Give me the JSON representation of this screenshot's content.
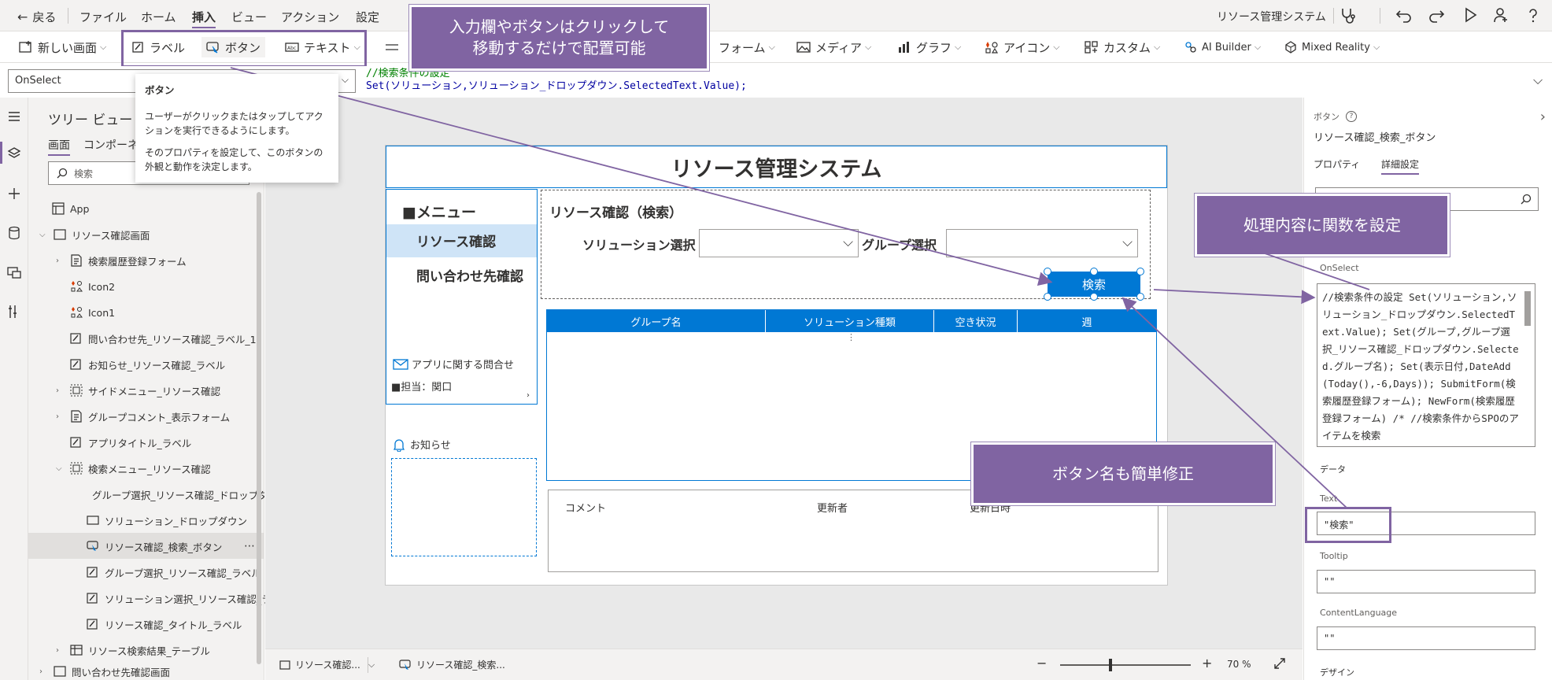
{
  "menubar": {
    "back": "戻る",
    "items": [
      "ファイル",
      "ホーム",
      "挿入",
      "ビュー",
      "アクション",
      "設定"
    ],
    "app_title": "リソース管理システム"
  },
  "ribbon": {
    "new_screen": "新しい画面",
    "label": "ラベル",
    "button": "ボタン",
    "text": "テキスト",
    "form": "フォーム",
    "media": "メディア",
    "chart": "グラフ",
    "icon": "アイコン",
    "custom": "カスタム",
    "ai_builder": "AI Builder",
    "mixed_reality": "Mixed Reality"
  },
  "formula": {
    "property": "OnSelect",
    "line1": "//検索条件の設定",
    "line2": "Set(ソリューション,ソリューション_ドロップダウン.SelectedText.Value);"
  },
  "tooltip": {
    "title": "ボタン",
    "desc1": "ユーザーがクリックまたはタップしてアクションを実行できるようにします。",
    "desc2": "そのプロパティを設定して、このボタンの外観と動作を決定します。"
  },
  "tree": {
    "title": "ツリー ビュー",
    "tab_screen": "画面",
    "tab_components": "コンポーネント",
    "search_placeholder": "検索",
    "nodes": [
      "App",
      "リソース確認画面",
      "検索履歴登録フォーム",
      "Icon2",
      "Icon1",
      "問い合わせ先_リソース確認_ラベル_1",
      "お知らせ_リソース確認_ラベル",
      "サイドメニュー_リソース確認",
      "グループコメント_表示フォーム",
      "アプリタイトル_ラベル",
      "検索メニュー_リソース確認",
      "グループ選択_リソース確認_ドロップダウン",
      "ソリューション_ドロップダウン",
      "リソース確認_検索_ボタン",
      "グループ選択_リソース確認_ラベル",
      "ソリューション選択_リソース確認_ラベル",
      "リソース確認_タイトル_ラベル",
      "リソース検索結果_テーブル",
      "問い合わせ先確認画面"
    ]
  },
  "app": {
    "title": "リソース管理システム",
    "menu_heading": "■メニュー",
    "menu_items": [
      "リソース確認",
      "問い合わせ先確認"
    ],
    "contact": "アプリに関する問合せ",
    "owner": "■担当：関口",
    "notice": "お知らせ",
    "search_title": "リソース確認（検索）",
    "solution_label": "ソリューション選択",
    "group_label": "グループ選択",
    "search_button": "検索",
    "table_headers": [
      "グループ名",
      "ソリューション種類",
      "空き状況",
      "週"
    ],
    "comment_headers": [
      "コメント",
      "更新者",
      "更新日時"
    ]
  },
  "status": {
    "screen_tab": "リソース確認...",
    "control_tab": "リソース確認_検索...",
    "zoom": "70",
    "zoom_unit": "%"
  },
  "panel": {
    "type": "ボタン",
    "name": "リソース確認_検索_ボタン",
    "tab_properties": "プロパティ",
    "tab_advanced": "詳細設定",
    "onselect_label": "OnSelect",
    "onselect_code": "//検索条件の設定 Set(ソリューション,ソリューション_ドロップダウン.SelectedText.Value); Set(グループ,グループ選択_リソース確認_ドロップダウン.Selected.グループ名); Set(表示日付,DateAdd(Today(),-6,Days)); SubmitForm(検索履歴登録フォーム); NewForm(検索履歴登録フォーム) /* //検索条件からSPOのアイテムを検索",
    "data_section": "データ",
    "text_label": "Text",
    "text_value": "\"検索\"",
    "tooltip_label": "Tooltip",
    "tooltip_value": "\"\"",
    "content_lang_label": "ContentLanguage",
    "content_lang_value": "\"\"",
    "design_section": "デザイン"
  },
  "callouts": {
    "insert": "入力欄やボタンはクリックして\n移動するだけで配置可能",
    "function": "処理内容に関数を設定",
    "rename": "ボタン名も簡単修正"
  },
  "colors": {
    "accent": "#0078d4",
    "callout": "#8064a2",
    "selected_menu": "#cfe4f7"
  }
}
